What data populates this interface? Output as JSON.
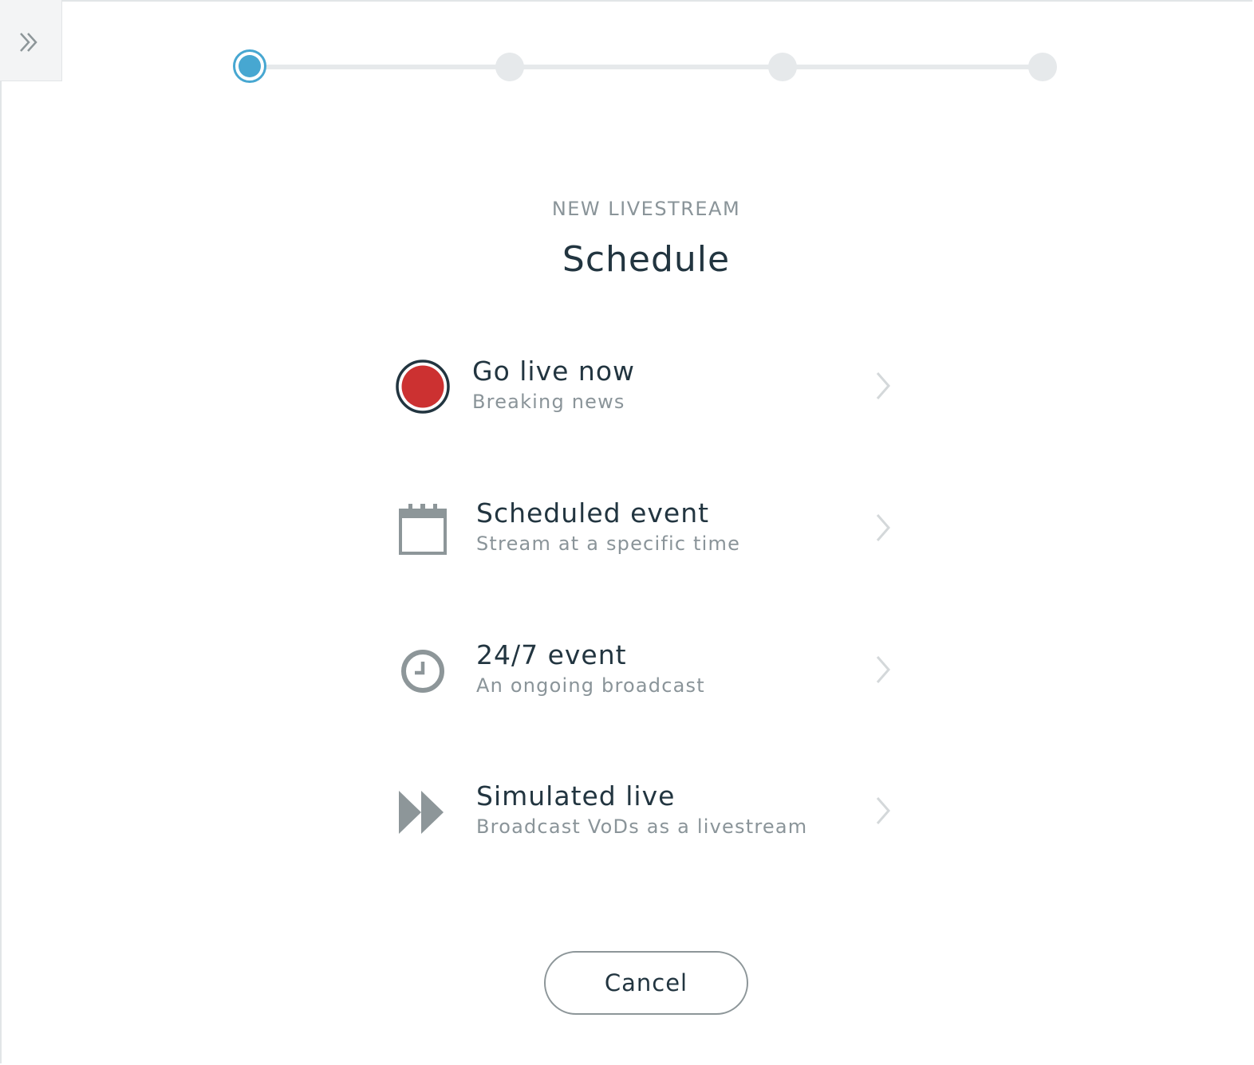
{
  "sidebar": {
    "toggle_icon": "double-chevron-right-icon"
  },
  "stepper": {
    "steps": [
      {
        "state": "active"
      },
      {
        "state": "inactive"
      },
      {
        "state": "inactive"
      },
      {
        "state": "inactive"
      }
    ],
    "active_color": "#47a7d1",
    "inactive_color": "#e6e9eb"
  },
  "header": {
    "eyebrow": "NEW LIVESTREAM",
    "title": "Schedule"
  },
  "options": [
    {
      "icon": "record-icon",
      "label": "Go live now",
      "sub": "Breaking news",
      "icon_color": "#cc3131"
    },
    {
      "icon": "calendar-icon",
      "label": "Scheduled event",
      "sub": "Stream at a specific time"
    },
    {
      "icon": "clock-icon",
      "label": "24/7 event",
      "sub": "An ongoing broadcast"
    },
    {
      "icon": "fast-forward-icon",
      "label": "Simulated live",
      "sub": "Broadcast VoDs as a livestream"
    }
  ],
  "footer": {
    "cancel_label": "Cancel"
  }
}
